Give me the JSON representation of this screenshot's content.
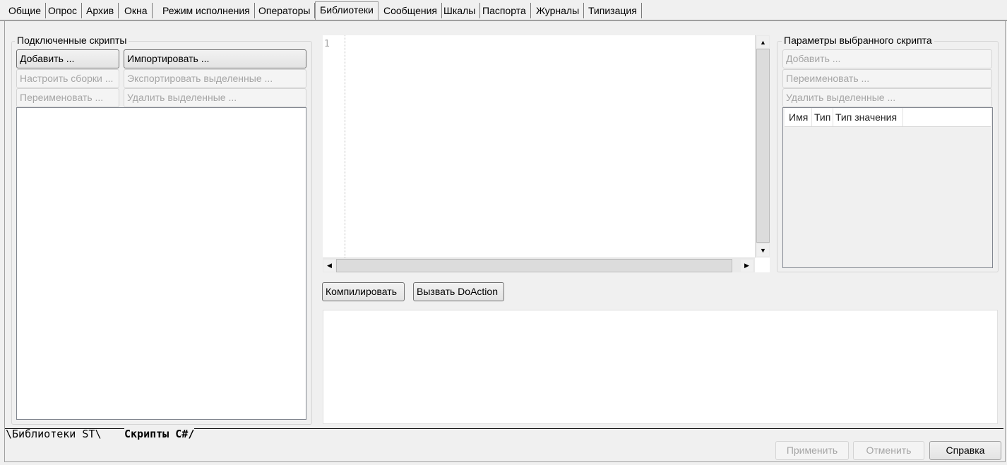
{
  "tabs": [
    "Общие",
    "Опрос",
    "Архив",
    "Окна",
    "Режим исполнения",
    "Операторы",
    "Библиотеки",
    "Сообщения",
    "Шкалы",
    "Паспорта",
    "Журналы",
    "Типизация"
  ],
  "active_tab": "Библиотеки",
  "left_panel": {
    "title": "Подключенные скрипты",
    "add": "Добавить ...",
    "import": "Импортировать ...",
    "configure": "Настроить сборки ...",
    "export": "Экспортировать выделенные ...",
    "rename": "Переименовать ...",
    "delete": "Удалить выделенные ..."
  },
  "editor": {
    "line_numbers": [
      "1"
    ],
    "compile": "Компилировать",
    "doaction": "Вызвать DoAction"
  },
  "right_panel": {
    "title": "Параметры выбранного скрипта",
    "add": "Добавить ...",
    "rename": "Переименовать ...",
    "delete": "Удалить выделенные ...",
    "columns": [
      "Имя",
      "Тип",
      "Тип значения"
    ]
  },
  "sheet_tabs": {
    "st": "Библиотеки ST",
    "cs": "Скрипты C#"
  },
  "footer": {
    "apply": "Применить",
    "cancel": "Отменить",
    "help": "Справка"
  }
}
